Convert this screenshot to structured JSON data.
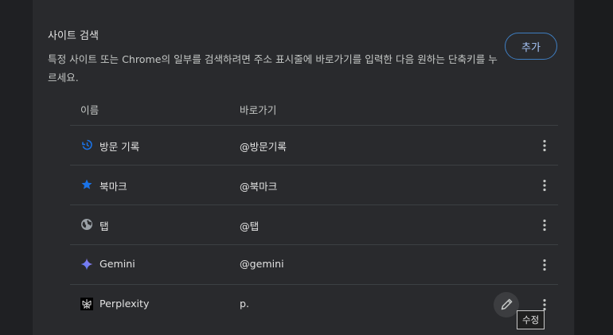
{
  "section": {
    "title": "사이트 검색",
    "description": "특정 사이트 또는 Chrome의 일부를 검색하려면 주소 표시줄에 바로가기를 입력한 다음 원하는 단축키를 누르세요.",
    "add_label": "추가"
  },
  "table": {
    "headers": {
      "name": "이름",
      "shortcut": "바로가기"
    },
    "rows": [
      {
        "name": "방문 기록",
        "shortcut": "@방문기록",
        "icon": "history-icon"
      },
      {
        "name": "북마크",
        "shortcut": "@북마크",
        "icon": "star-icon"
      },
      {
        "name": "탭",
        "shortcut": "@탭",
        "icon": "globe-icon"
      },
      {
        "name": "Gemini",
        "shortcut": "@gemini",
        "icon": "gemini-icon"
      },
      {
        "name": "Perplexity",
        "shortcut": "p.",
        "icon": "perplexity-icon"
      }
    ]
  },
  "tooltip": {
    "edit": "수정"
  },
  "colors": {
    "background": "#202124",
    "card": "#292a2d",
    "accent": "#a8c7fa",
    "accent_border": "#3f7ec1",
    "blue_icon": "#1a73e8",
    "divider": "#3c4043"
  }
}
